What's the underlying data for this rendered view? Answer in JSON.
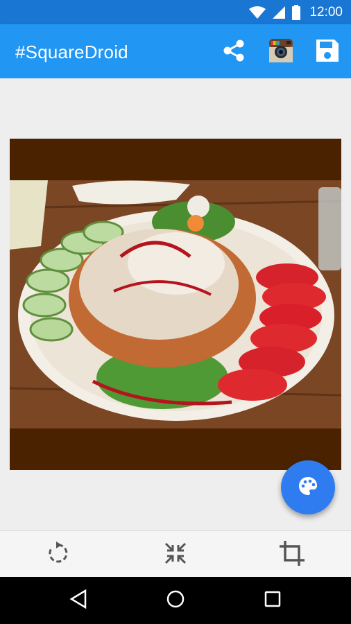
{
  "status_bar": {
    "time": "12:00"
  },
  "app_bar": {
    "title": "#SquareDroid"
  },
  "colors": {
    "primary": "#2196f3",
    "primary_dark": "#1976d2",
    "fab": "#2f7cf0",
    "photo_background": "#4b2200"
  },
  "icons": {
    "status": [
      "wifi-icon",
      "cellular-signal-icon",
      "battery-icon"
    ],
    "actions": [
      "share-icon",
      "instagram-icon",
      "save-icon"
    ],
    "fab": "palette-icon",
    "tools": [
      "rotate-icon",
      "shrink-icon",
      "crop-icon"
    ],
    "nav": [
      "back-icon",
      "home-icon",
      "recents-icon"
    ]
  }
}
